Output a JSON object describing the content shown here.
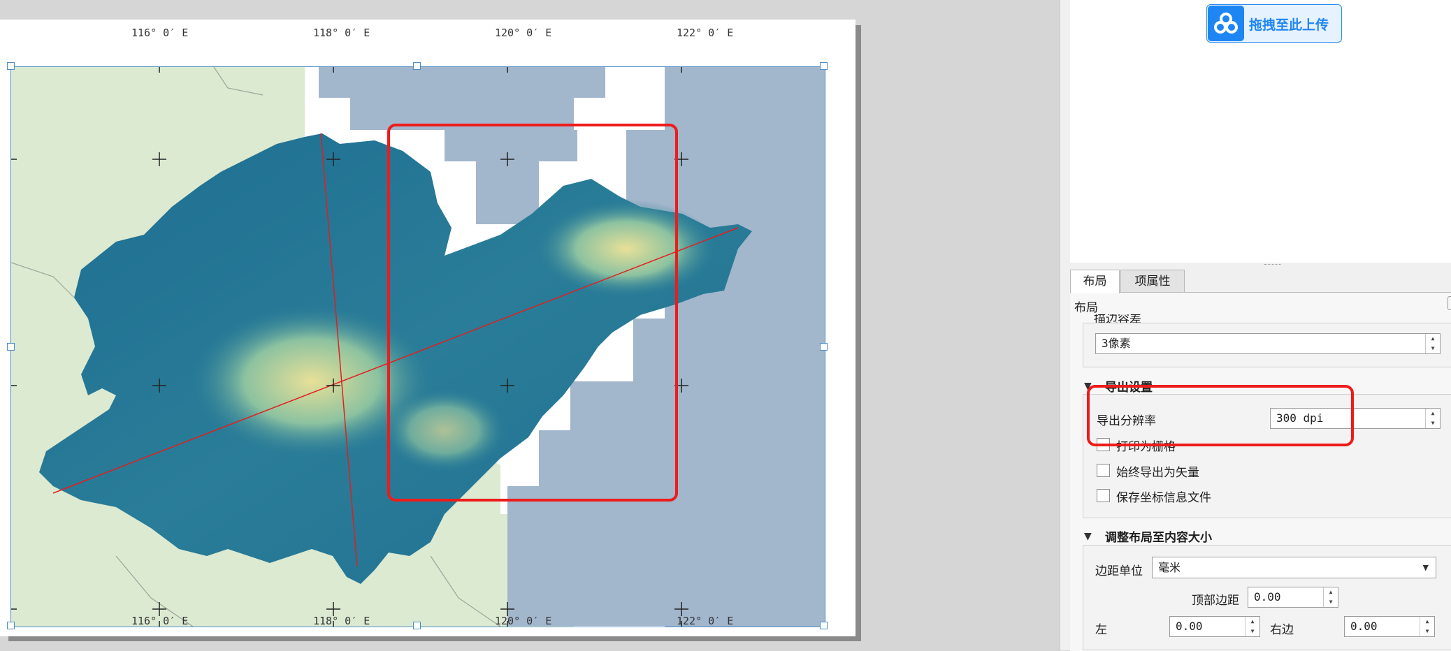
{
  "map": {
    "top_tick_labels": [
      "116° 0′ E",
      "118° 0′ E",
      "120° 0′ E",
      "122° 0′ E"
    ],
    "bottom_tick_labels": [
      "116° 0′ E",
      "118° 0′ E",
      "120° 0′ E",
      "122° 0′ E"
    ],
    "colors": {
      "land_background": "#dcead2",
      "sea_tiles": "#a2b6cc",
      "dem_low": "#1d6d92",
      "dem_mid": "#6fb6a0",
      "dem_high": "#e8e098",
      "annotation": "#ee1b1b",
      "frame": "#4f8fc8"
    }
  },
  "panel": {
    "upload_button": {
      "label": "拖拽至此上传",
      "icon": "baidu-netdisk-icon"
    },
    "tabs": [
      {
        "label": "布局",
        "active": true
      },
      {
        "label": "项属性",
        "active": false
      }
    ],
    "section_title": "布局",
    "cut_off_label": "描边容差",
    "stroke_value": "3像素",
    "export_settings": {
      "header": "导出设置",
      "resolution_label": "导出分辨率",
      "resolution_value": "300 dpi",
      "print_as_raster": "打印为栅格",
      "always_export_vector": "始终导出为矢量",
      "save_world_file": "保存坐标信息文件"
    },
    "resize_layout": {
      "header": "调整布局至内容大小",
      "margin_unit_label": "边距单位",
      "margin_unit_value": "毫米",
      "top_margin_label": "顶部边距",
      "top_margin_value": "0.00",
      "left_label": "左",
      "left_value": "0.00",
      "right_label": "右边",
      "right_value": "0.00"
    }
  }
}
